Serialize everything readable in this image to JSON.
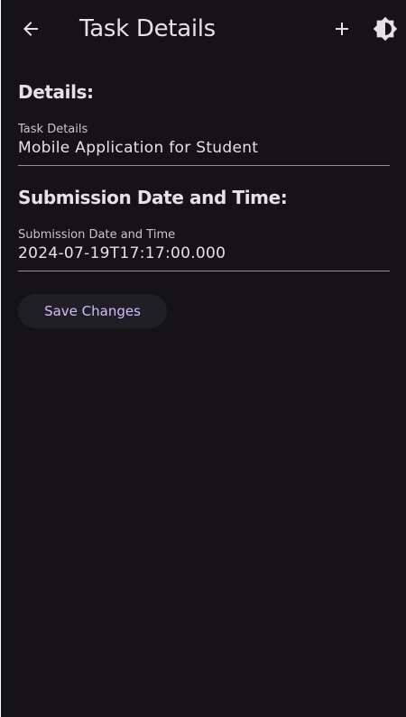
{
  "appbar": {
    "title": "Task Details",
    "back_icon": "arrow-back-icon",
    "add_icon": "add-icon",
    "theme_icon": "brightness-icon"
  },
  "details": {
    "heading": "Details:",
    "field_label": "Task Details",
    "field_value": "Mobile Application for Student"
  },
  "submission": {
    "heading": "Submission Date and Time:",
    "field_label": "Submission Date and Time",
    "field_value": "2024-07-19T17:17:00.000"
  },
  "save_button_label": "Save Changes",
  "colors": {
    "background": "#151218",
    "text": "#e8e0e8",
    "accent": "#d0bcff",
    "button_bg": "#211f26",
    "divider": "#938f99"
  }
}
